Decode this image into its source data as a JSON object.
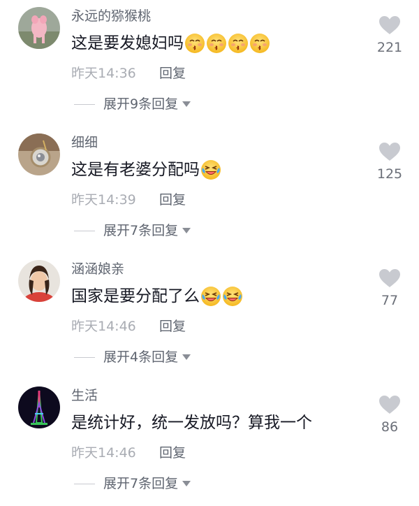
{
  "colors": {
    "username": "#5f6570",
    "text": "#161823",
    "meta": "#a9acb3",
    "heart": "#c8cad0"
  },
  "comments": [
    {
      "username": "永远的猕猴桃",
      "text": "这是要发媳妇吗",
      "emojis": [
        "kiss-emoji",
        "kiss-emoji",
        "kiss-emoji",
        "kiss-emoji"
      ],
      "time": "昨天14:36",
      "reply": "回复",
      "expand": "展开9条回复",
      "likes": "221"
    },
    {
      "username": "细细",
      "text": "这是有老婆分配吗",
      "emojis": [
        "laugh-cry-emoji"
      ],
      "time": "昨天14:39",
      "reply": "回复",
      "expand": "展开7条回复",
      "likes": "125"
    },
    {
      "username": "涵涵娘亲",
      "text": "国家是要分配了么",
      "emojis": [
        "laugh-cry-emoji",
        "laugh-cry-emoji"
      ],
      "time": "昨天14:46",
      "reply": "回复",
      "expand": "展开4条回复",
      "likes": "77"
    },
    {
      "username": "生活",
      "text": "是统计好，统一发放吗？算我一个",
      "emojis": [],
      "time": "昨天14:46",
      "reply": "回复",
      "expand": "展开7条回复",
      "likes": "86"
    }
  ]
}
